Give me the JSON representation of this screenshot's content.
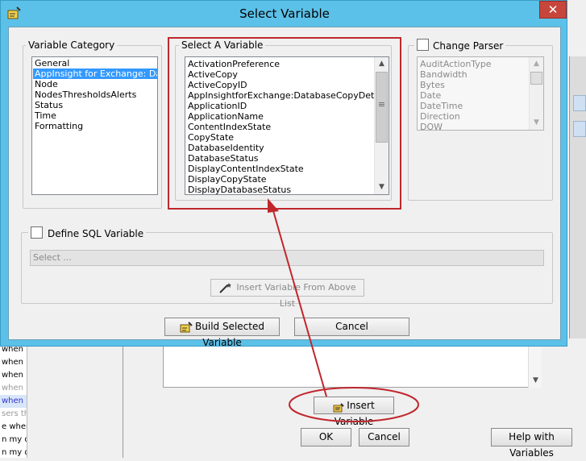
{
  "dialog": {
    "title": "Select Variable",
    "close_glyph": "✕"
  },
  "variable_category": {
    "legend": "Variable Category",
    "items": [
      "General",
      "AppInsight for Exchange: Datab",
      "Node",
      "NodesThresholdsAlerts",
      "Status",
      "Time",
      "Formatting"
    ],
    "selected_index": 1
  },
  "select_variable": {
    "legend": "Select A Variable",
    "items": [
      "ActivationPreference",
      "ActiveCopy",
      "ActiveCopyID",
      "AppInsightforExchange:DatabaseCopyDetailsUR",
      "ApplicationID",
      "ApplicationName",
      "ContentIndexState",
      "CopyState",
      "DatabaseIdentity",
      "DatabaseStatus",
      "DisplayContentIndexState",
      "DisplayCopyState",
      "DisplayDatabaseStatus"
    ],
    "scroll_up": "▲",
    "scroll_down": "▼",
    "grip": "≡"
  },
  "change_parser": {
    "label": "Change Parser",
    "checked": false,
    "items": [
      "AuditActionType",
      "Bandwidth",
      "Bytes",
      "Date",
      "DateTime",
      "Direction",
      "DOW"
    ]
  },
  "sql": {
    "label": "Define SQL Variable",
    "checked": false,
    "select_placeholder": "Select ...",
    "insert_button": "Insert Variable From Above List"
  },
  "buttons": {
    "build": "Build Selected Variable",
    "cancel": "Cancel"
  },
  "background": {
    "insert_variable": "Insert Variable",
    "ok": "OK",
    "cancel": "Cancel",
    "help": "Help with Variables",
    "left_lines": [
      "when",
      "when",
      "when",
      "when",
      "when",
      "sers tha",
      "e wher",
      "n my da",
      "n my da"
    ]
  },
  "colors": {
    "title_bar": "#5cc1e8",
    "close": "#c7463c",
    "selection": "#3399ff",
    "annotation": "#c0272d"
  }
}
